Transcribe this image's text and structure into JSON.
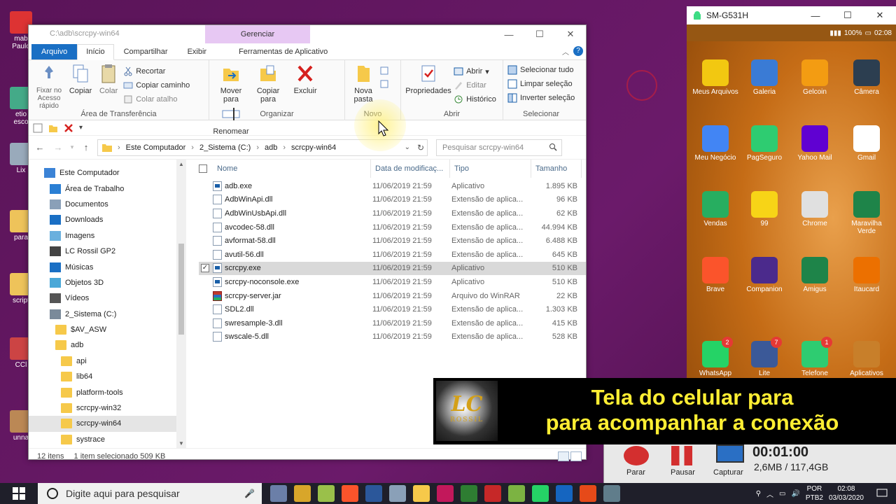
{
  "explorer": {
    "title_path": "C:\\adb\\scrcpy-win64",
    "context_tab": "Gerenciar",
    "tabs": [
      "Arquivo",
      "Início",
      "Compartilhar",
      "Exibir",
      "Ferramentas de Aplicativo"
    ],
    "ribbon": {
      "clipboard": {
        "label": "Área de Transferência",
        "quick_access": "Fixar no Acesso rápido",
        "copy": "Copiar",
        "paste": "Colar",
        "cut": "Recortar",
        "copy_path": "Copiar caminho",
        "paste_shortcut": "Colar atalho"
      },
      "organize": {
        "label": "Organizar",
        "move_to": "Mover para",
        "copy_to": "Copiar para",
        "delete": "Excluir",
        "rename": "Renomear"
      },
      "new": {
        "label": "Novo",
        "new_folder": "Nova pasta"
      },
      "open": {
        "label": "Abrir",
        "properties": "Propriedades",
        "open": "Abrir",
        "edit": "Editar",
        "history": "Histórico"
      },
      "select": {
        "label": "Selecionar",
        "select_all": "Selecionar tudo",
        "select_none": "Limpar seleção",
        "invert": "Inverter seleção"
      }
    },
    "address": {
      "crumbs": [
        "Este Computador",
        "2_Sistema (C:)",
        "adb",
        "scrcpy-win64"
      ],
      "search_placeholder": "Pesquisar scrcpy-win64"
    },
    "nav_items": [
      {
        "label": "Este Computador",
        "icon": "computer-icon",
        "indent": 0
      },
      {
        "label": "Área de Trabalho",
        "icon": "desktop-icon",
        "indent": 1
      },
      {
        "label": "Documentos",
        "icon": "documents-icon",
        "indent": 1
      },
      {
        "label": "Downloads",
        "icon": "downloads-icon",
        "indent": 1
      },
      {
        "label": "Imagens",
        "icon": "images-icon",
        "indent": 1
      },
      {
        "label": "LC Rossil GP2",
        "icon": "device-icon",
        "indent": 1
      },
      {
        "label": "Músicas",
        "icon": "music-icon",
        "indent": 1
      },
      {
        "label": "Objetos 3D",
        "icon": "objects3d-icon",
        "indent": 1
      },
      {
        "label": "Vídeos",
        "icon": "videos-icon",
        "indent": 1
      },
      {
        "label": "2_Sistema (C:)",
        "icon": "drive-icon",
        "indent": 1
      },
      {
        "label": "$AV_ASW",
        "icon": "folder-icon",
        "indent": 2
      },
      {
        "label": "adb",
        "icon": "folder-icon",
        "indent": 2
      },
      {
        "label": "api",
        "icon": "folder-icon",
        "indent": 3
      },
      {
        "label": "lib64",
        "icon": "folder-icon",
        "indent": 3
      },
      {
        "label": "platform-tools",
        "icon": "folder-icon",
        "indent": 3
      },
      {
        "label": "scrcpy-win32",
        "icon": "folder-icon",
        "indent": 3
      },
      {
        "label": "scrcpy-win64",
        "icon": "folder-icon",
        "indent": 3,
        "selected": true
      },
      {
        "label": "systrace",
        "icon": "folder-icon",
        "indent": 3
      }
    ],
    "columns": [
      "Nome",
      "Data de modificaç...",
      "Tipo",
      "Tamanho"
    ],
    "files": [
      {
        "name": "adb.exe",
        "date": "11/06/2019 21:59",
        "type": "Aplicativo",
        "size": "1.895 KB",
        "icon": "exe"
      },
      {
        "name": "AdbWinApi.dll",
        "date": "11/06/2019 21:59",
        "type": "Extensão de aplica...",
        "size": "96 KB",
        "icon": "dll"
      },
      {
        "name": "AdbWinUsbApi.dll",
        "date": "11/06/2019 21:59",
        "type": "Extensão de aplica...",
        "size": "62 KB",
        "icon": "dll"
      },
      {
        "name": "avcodec-58.dll",
        "date": "11/06/2019 21:59",
        "type": "Extensão de aplica...",
        "size": "44.994 KB",
        "icon": "dll"
      },
      {
        "name": "avformat-58.dll",
        "date": "11/06/2019 21:59",
        "type": "Extensão de aplica...",
        "size": "6.488 KB",
        "icon": "dll"
      },
      {
        "name": "avutil-56.dll",
        "date": "11/06/2019 21:59",
        "type": "Extensão de aplica...",
        "size": "645 KB",
        "icon": "dll"
      },
      {
        "name": "scrcpy.exe",
        "date": "11/06/2019 21:59",
        "type": "Aplicativo",
        "size": "510 KB",
        "icon": "exe",
        "selected": true
      },
      {
        "name": "scrcpy-noconsole.exe",
        "date": "11/06/2019 21:59",
        "type": "Aplicativo",
        "size": "510 KB",
        "icon": "exe"
      },
      {
        "name": "scrcpy-server.jar",
        "date": "11/06/2019 21:59",
        "type": "Arquivo do WinRAR",
        "size": "22 KB",
        "icon": "jar"
      },
      {
        "name": "SDL2.dll",
        "date": "11/06/2019 21:59",
        "type": "Extensão de aplica...",
        "size": "1.303 KB",
        "icon": "dll"
      },
      {
        "name": "swresample-3.dll",
        "date": "11/06/2019 21:59",
        "type": "Extensão de aplica...",
        "size": "415 KB",
        "icon": "dll"
      },
      {
        "name": "swscale-5.dll",
        "date": "11/06/2019 21:59",
        "type": "Extensão de aplica...",
        "size": "528 KB",
        "icon": "dll"
      }
    ],
    "status": {
      "count": "12 itens",
      "selection": "1 item selecionado  509 KB"
    }
  },
  "phone": {
    "title": "SM-G531H",
    "battery": "100%",
    "time": "02:08",
    "apps": [
      {
        "label": "Meus Arquivos",
        "color": "#f2c811"
      },
      {
        "label": "Galeria",
        "color": "#3a7bd5"
      },
      {
        "label": "Gelcoin",
        "color": "#f39c12"
      },
      {
        "label": "Câmera",
        "color": "#2c3e50"
      },
      {
        "label": "Meu Negócio",
        "color": "#4285f4"
      },
      {
        "label": "PagSeguro",
        "color": "#2ecc71"
      },
      {
        "label": "Yahoo Mail",
        "color": "#6001d2"
      },
      {
        "label": "Gmail",
        "color": "#ffffff"
      },
      {
        "label": "Vendas",
        "color": "#27ae60"
      },
      {
        "label": "99",
        "color": "#f7d417"
      },
      {
        "label": "Chrome",
        "color": "#e0e0e0"
      },
      {
        "label": "Maravilha Verde",
        "color": "#1e8449"
      },
      {
        "label": "Brave",
        "color": "#fb542b"
      },
      {
        "label": "Companion",
        "color": "#4b2a8c"
      },
      {
        "label": "Amigus",
        "color": "#1e8449"
      },
      {
        "label": "Itaucard",
        "color": "#ec7000"
      },
      {
        "label": "WhatsApp",
        "color": "#25d366",
        "badge": "2"
      },
      {
        "label": "Lite",
        "color": "#3b5998",
        "badge": "7"
      },
      {
        "label": "Telefone",
        "color": "#2ecc71",
        "badge": "1"
      },
      {
        "label": "Aplicativos",
        "color": "#c87f2a"
      }
    ]
  },
  "banner": {
    "logo_text": "LC",
    "logo_sub": "ROSSIL",
    "line1": "Tela do celular para",
    "line2": "para acompanhar a conexão"
  },
  "recorder": {
    "stop": "Parar",
    "pause": "Pausar",
    "capture": "Capturar",
    "time": "00:01:00",
    "size": "2,6MB / 117,4GB"
  },
  "taskbar": {
    "search_placeholder": "Digite aqui para pesquisar",
    "lang1": "POR",
    "lang2": "PTB2",
    "time": "02:08",
    "date": "03/03/2020"
  },
  "desktop_icons": [
    "mab Paulo",
    "etio esco",
    "Lix",
    "para",
    "script",
    "CCl",
    "unna"
  ]
}
